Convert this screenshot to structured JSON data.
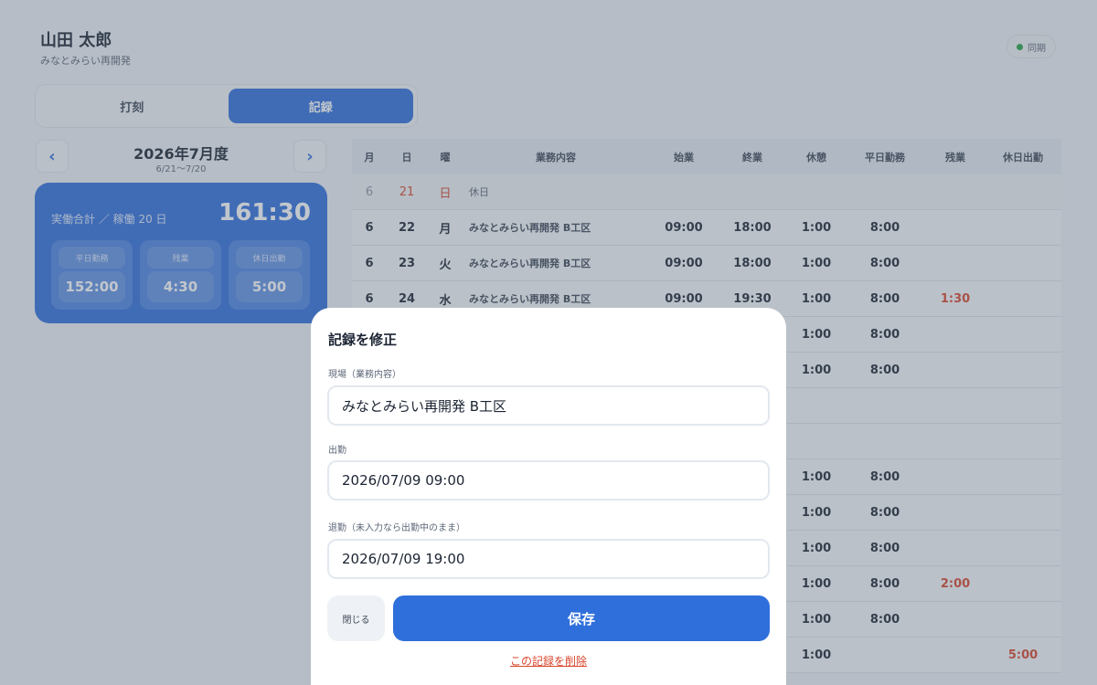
{
  "header": {
    "user_name": "山田 太郎",
    "site": "みなとみらい再開発",
    "sync_label": "同期",
    "sync_color": "#25a244"
  },
  "tabs": [
    {
      "label": "打刻",
      "active": false
    },
    {
      "label": "記録",
      "active": true
    }
  ],
  "month_nav": {
    "prev_icon": "chevron-left",
    "next_icon": "chevron-right",
    "prev_glyph": "‹",
    "next_glyph": "›",
    "title": "2026年7月度",
    "range": "6/21〜7/20"
  },
  "summary": {
    "label": "実働合計 ／ 稼働 20 日",
    "total": "161:30",
    "stats": [
      {
        "label": "平日勤務",
        "value": "152:00"
      },
      {
        "label": "残業",
        "value": "4:30"
      },
      {
        "label": "休日出勤",
        "value": "5:00"
      }
    ]
  },
  "table": {
    "headers": [
      "月",
      "日",
      "曜",
      "業務内容",
      "始業",
      "終業",
      "休憩",
      "平日勤務",
      "残業",
      "休日出勤"
    ],
    "rows": [
      {
        "month": "6",
        "day": "21",
        "weekday": "日",
        "task": "休日",
        "start": "",
        "end": "",
        "break": "",
        "weekday_work": "",
        "overtime": "",
        "holiday_work": "",
        "holiday": true
      },
      {
        "month": "6",
        "day": "22",
        "weekday": "月",
        "task": "みなとみらい再開発 B工区",
        "start": "09:00",
        "end": "18:00",
        "break": "1:00",
        "weekday_work": "8:00",
        "overtime": "",
        "holiday_work": ""
      },
      {
        "month": "6",
        "day": "23",
        "weekday": "火",
        "task": "みなとみらい再開発 B工区",
        "start": "09:00",
        "end": "18:00",
        "break": "1:00",
        "weekday_work": "8:00",
        "overtime": "",
        "holiday_work": ""
      },
      {
        "month": "6",
        "day": "24",
        "weekday": "水",
        "task": "みなとみらい再開発 B工区",
        "start": "09:00",
        "end": "19:30",
        "break": "1:00",
        "weekday_work": "8:00",
        "overtime": "1:30",
        "holiday_work": ""
      },
      {
        "month": "",
        "day": "",
        "weekday": "",
        "task": "",
        "start": "",
        "end": "",
        "break": "1:00",
        "weekday_work": "8:00",
        "overtime": "",
        "holiday_work": ""
      },
      {
        "month": "",
        "day": "",
        "weekday": "",
        "task": "",
        "start": "",
        "end": "",
        "break": "1:00",
        "weekday_work": "8:00",
        "overtime": "",
        "holiday_work": ""
      },
      {
        "month": "",
        "day": "",
        "weekday": "",
        "task": "",
        "start": "",
        "end": "",
        "break": "",
        "weekday_work": "",
        "overtime": "",
        "holiday_work": ""
      },
      {
        "month": "",
        "day": "",
        "weekday": "",
        "task": "",
        "start": "",
        "end": "",
        "break": "",
        "weekday_work": "",
        "overtime": "",
        "holiday_work": ""
      },
      {
        "month": "",
        "day": "",
        "weekday": "",
        "task": "",
        "start": "",
        "end": "",
        "break": "1:00",
        "weekday_work": "8:00",
        "overtime": "",
        "holiday_work": ""
      },
      {
        "month": "",
        "day": "",
        "weekday": "",
        "task": "",
        "start": "",
        "end": "",
        "break": "1:00",
        "weekday_work": "8:00",
        "overtime": "",
        "holiday_work": ""
      },
      {
        "month": "",
        "day": "",
        "weekday": "",
        "task": "",
        "start": "",
        "end": "",
        "break": "1:00",
        "weekday_work": "8:00",
        "overtime": "",
        "holiday_work": ""
      },
      {
        "month": "",
        "day": "",
        "weekday": "",
        "task": "",
        "start": "",
        "end": "",
        "break": "1:00",
        "weekday_work": "8:00",
        "overtime": "2:00",
        "holiday_work": ""
      },
      {
        "month": "",
        "day": "",
        "weekday": "",
        "task": "",
        "start": "",
        "end": "",
        "break": "1:00",
        "weekday_work": "8:00",
        "overtime": "",
        "holiday_work": ""
      },
      {
        "month": "",
        "day": "",
        "weekday": "",
        "task": "",
        "start": "",
        "end": "",
        "break": "1:00",
        "weekday_work": "",
        "overtime": "",
        "holiday_work": "5:00"
      }
    ]
  },
  "modal": {
    "title": "記録を修正",
    "site_label": "現場（業務内容）",
    "site_value": "みなとみらい再開発 B工区",
    "in_label": "出勤",
    "in_value": "2026/07/09 09:00",
    "out_label": "退勤（未入力なら出勤中のまま）",
    "out_value": "2026/07/09 19:00",
    "close_label": "閉じる",
    "save_label": "保存",
    "delete_label": "この記録を削除"
  },
  "colors": {
    "accent": "#2f6fdb",
    "danger": "#d9452b",
    "background": "#eef1f6"
  }
}
